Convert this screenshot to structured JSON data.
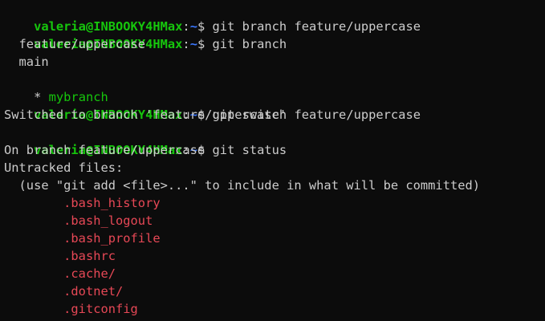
{
  "prompt": {
    "user_host": "valeria@INBOOKY4HMax",
    "sep": ":",
    "path": "~",
    "symbol": "$"
  },
  "lines": {
    "cmd1": "git branch feature/uppercase",
    "cmd2": "git branch",
    "branch_list": {
      "b1": "  feature/uppercase",
      "b2": "  main",
      "current_marker": "* ",
      "b3": "mybranch"
    },
    "cmd3": "git switch feature/uppercase",
    "switched": "Switched to branch 'feature/uppercase'",
    "cmd4": "git status",
    "on_branch": "On branch feature/uppercase",
    "untracked_header": "Untracked files:",
    "hint": "  (use \"git add <file>...\" to include in what will be committed)",
    "untracked_files": [
      ".bash_history",
      ".bash_logout",
      ".bash_profile",
      ".bashrc",
      ".cache/",
      ".dotnet/",
      ".gitconfig"
    ]
  },
  "colors": {
    "background": "#0c0c0c",
    "text": "#cccccc",
    "prompt_user": "#16c60c",
    "prompt_path": "#3b78ff",
    "current_branch": "#16c60c",
    "untracked": "#e74856"
  }
}
